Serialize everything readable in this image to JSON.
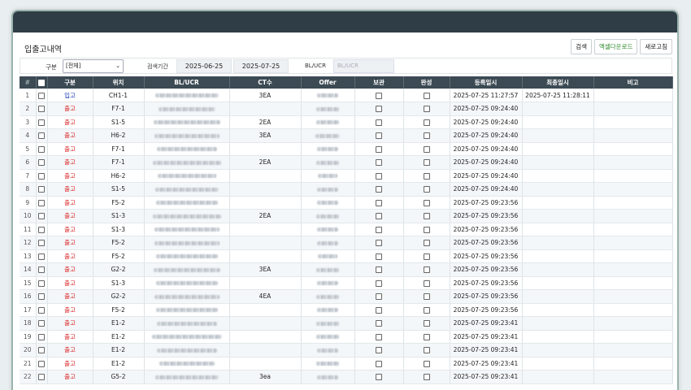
{
  "page": {
    "title": "입출고내역"
  },
  "toolbar": {
    "search_label": "검색",
    "excel_label": "엑셀다운로드",
    "refresh_label": "새로고침"
  },
  "filters": {
    "type_label": "구분",
    "type_value": "[전체]",
    "period_label": "검색기간",
    "date_from": "2025-06-25",
    "date_to": "2025-07-25",
    "bl_label": "BL/UCR",
    "bl_placeholder": "BL/UCR"
  },
  "table": {
    "headers": [
      "#",
      "",
      "구분",
      "위치",
      "BL/UCR",
      "CT수",
      "Offer",
      "보관",
      "완성",
      "등록일시",
      "최종일시",
      "비고"
    ],
    "rows": [
      {
        "n": "1",
        "type": "입고",
        "loc": "CH1-1",
        "ct": "3EA",
        "reg": "2025-07-25 11:27:57",
        "last": "2025-07-25 11:28:11"
      },
      {
        "n": "2",
        "type": "출고",
        "loc": "F7-1",
        "ct": "",
        "reg": "2025-07-25 09:24:40",
        "last": ""
      },
      {
        "n": "3",
        "type": "출고",
        "loc": "S1-5",
        "ct": "2EA",
        "reg": "2025-07-25 09:24:40",
        "last": ""
      },
      {
        "n": "4",
        "type": "출고",
        "loc": "H6-2",
        "ct": "3EA",
        "reg": "2025-07-25 09:24:40",
        "last": ""
      },
      {
        "n": "5",
        "type": "출고",
        "loc": "F7-1",
        "ct": "",
        "reg": "2025-07-25 09:24:40",
        "last": ""
      },
      {
        "n": "6",
        "type": "출고",
        "loc": "F7-1",
        "ct": "2EA",
        "reg": "2025-07-25 09:24:40",
        "last": ""
      },
      {
        "n": "7",
        "type": "출고",
        "loc": "H6-2",
        "ct": "",
        "reg": "2025-07-25 09:24:40",
        "last": ""
      },
      {
        "n": "8",
        "type": "출고",
        "loc": "S1-5",
        "ct": "",
        "reg": "2025-07-25 09:24:40",
        "last": ""
      },
      {
        "n": "9",
        "type": "출고",
        "loc": "F5-2",
        "ct": "",
        "reg": "2025-07-25 09:23:56",
        "last": ""
      },
      {
        "n": "10",
        "type": "출고",
        "loc": "S1-3",
        "ct": "2EA",
        "reg": "2025-07-25 09:23:56",
        "last": ""
      },
      {
        "n": "11",
        "type": "출고",
        "loc": "S1-3",
        "ct": "",
        "reg": "2025-07-25 09:23:56",
        "last": ""
      },
      {
        "n": "12",
        "type": "출고",
        "loc": "F5-2",
        "ct": "",
        "reg": "2025-07-25 09:23:56",
        "last": ""
      },
      {
        "n": "13",
        "type": "출고",
        "loc": "F5-2",
        "ct": "",
        "reg": "2025-07-25 09:23:56",
        "last": ""
      },
      {
        "n": "14",
        "type": "출고",
        "loc": "G2-2",
        "ct": "3EA",
        "reg": "2025-07-25 09:23:56",
        "last": ""
      },
      {
        "n": "15",
        "type": "출고",
        "loc": "S1-3",
        "ct": "",
        "reg": "2025-07-25 09:23:56",
        "last": ""
      },
      {
        "n": "16",
        "type": "출고",
        "loc": "G2-2",
        "ct": "4EA",
        "reg": "2025-07-25 09:23:56",
        "last": ""
      },
      {
        "n": "17",
        "type": "출고",
        "loc": "F5-2",
        "ct": "",
        "reg": "2025-07-25 09:23:56",
        "last": ""
      },
      {
        "n": "18",
        "type": "출고",
        "loc": "E1-2",
        "ct": "",
        "reg": "2025-07-25 09:23:41",
        "last": ""
      },
      {
        "n": "19",
        "type": "출고",
        "loc": "E1-2",
        "ct": "",
        "reg": "2025-07-25 09:23:41",
        "last": ""
      },
      {
        "n": "20",
        "type": "출고",
        "loc": "E1-2",
        "ct": "",
        "reg": "2025-07-25 09:23:41",
        "last": ""
      },
      {
        "n": "21",
        "type": "출고",
        "loc": "E1-2",
        "ct": "",
        "reg": "2025-07-25 09:23:41",
        "last": ""
      },
      {
        "n": "22",
        "type": "출고",
        "loc": "G5-2",
        "ct": "3ea",
        "reg": "2025-07-25 09:23:41",
        "last": ""
      }
    ]
  }
}
